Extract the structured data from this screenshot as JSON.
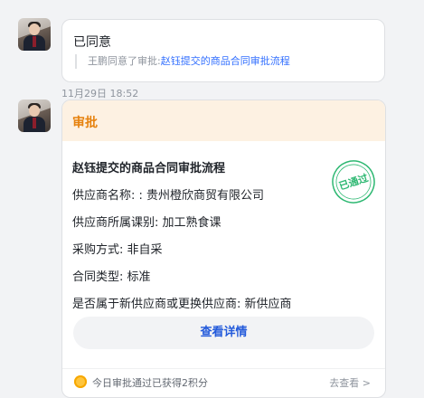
{
  "messages": [
    {
      "title": "已同意",
      "quote_prefix": "王鹏同意了审批:",
      "quote_link": "赵钰提交的商品合同审批流程"
    }
  ],
  "timestamp": "11月29日 18:52",
  "card": {
    "header": "审批",
    "title": "赵钰提交的商品合同审批流程",
    "stamp_text": "已通过",
    "fields": [
      "供应商名称: : 贵州橙欣商贸有限公司",
      "供应商所属课别: 加工熟食课",
      "采购方式: 非自采",
      "合同类型: 标准",
      "是否属于新供应商或更换供应商: 新供应商"
    ],
    "detail_button": "查看详情",
    "footer_text": "今日审批通过已获得2积分",
    "footer_link": "去查看 >"
  },
  "colors": {
    "accent_orange": "#e6820e",
    "link_blue": "#3370ff",
    "stamp_green": "#2eb872"
  },
  "icons": {
    "avatar": "user-avatar",
    "coin": "coin-icon",
    "stamp": "approved-stamp-icon"
  }
}
